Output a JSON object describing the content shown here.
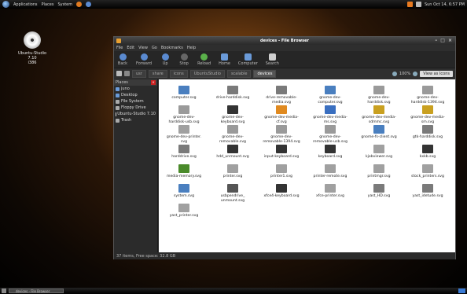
{
  "top_panel": {
    "menus": [
      "Applications",
      "Places",
      "System"
    ],
    "clock": "Sun Oct 14, 6:57 PM"
  },
  "desktop": {
    "icon_label_line1": "Ubuntu-Studio 7.10",
    "icon_label_line2": "i386"
  },
  "window": {
    "title": "devices - File Browser",
    "menu": [
      "File",
      "Edit",
      "View",
      "Go",
      "Bookmarks",
      "Help"
    ],
    "toolbar": [
      "Back",
      "Forward",
      "Up",
      "Stop",
      "Reload",
      "Home",
      "Computer",
      "Search"
    ],
    "breadcrumbs": [
      "usr",
      "share",
      "icons",
      "UbuntuStudio",
      "scalable",
      "devices"
    ],
    "zoom_label": "100%",
    "view_mode": "View as Icons",
    "sidebar_title": "Places",
    "sidebar_items": [
      "juno",
      "Desktop",
      "File System",
      "Floppy Drive",
      "Ubuntu-Studio 7.10",
      "Trash"
    ],
    "status": "37 items, Free space: 32.8 GB",
    "files": [
      [
        "computer.svg"
      ],
      [
        "drive-harddisk.svg"
      ],
      [
        "drive-removable-",
        "media.svg"
      ],
      [
        "gnome-dev-",
        "computer.svg"
      ],
      [
        "gnome-dev-",
        "harddisk.svg"
      ],
      [
        "gnome-dev-",
        "harddisk-1394.svg"
      ],
      [
        "gnome-dev-",
        "harddisk-usb.svg"
      ],
      [
        "gnome-dev-",
        "keyboard.svg"
      ],
      [
        "gnome-dev-media-",
        "cf.svg"
      ],
      [
        "gnome-dev-media-",
        "ms.svg"
      ],
      [
        "gnome-dev-media-",
        "sdmmc.svg"
      ],
      [
        "gnome-dev-media-",
        "sm.svg"
      ],
      [
        "gnome-dev-printer.",
        "svg"
      ],
      [
        "gnome-dev-",
        "removable.svg"
      ],
      [
        "gnome-dev-",
        "removable-1394.svg"
      ],
      [
        "gnome-dev-",
        "removable-usb.svg"
      ],
      [
        "gnome-fs-client.svg"
      ],
      [
        "gtk-harddisk.svg"
      ],
      [
        "harddrive.svg"
      ],
      [
        "hdd_unmount.svg"
      ],
      [
        "input-keyboard.svg"
      ],
      [
        "keyboard.svg"
      ],
      [
        "kjobviewer.svg"
      ],
      [
        "kxkb.svg"
      ],
      [
        "media-memory.svg"
      ],
      [
        "printer.svg"
      ],
      [
        "printer1.svg"
      ],
      [
        "printer-remote.svg"
      ],
      [
        "printmgr.svg"
      ],
      [
        "stock_printers.svg"
      ],
      [
        "system.svg"
      ],
      [
        "usbpendrive_",
        "unmount.svg"
      ],
      [
        "xfce4-keyboard.svg"
      ],
      [
        "xfce-printer.svg"
      ],
      [
        "yast_HD.svg"
      ],
      [
        "yast_idetude.svg"
      ],
      [
        "yast_printer.svg"
      ]
    ],
    "file_icon_kinds": [
      "monitor",
      "drive",
      "drive",
      "monitor",
      "disk-doc",
      "disk-doc",
      "disk-doc",
      "keyboard",
      "card-orange",
      "card-blue",
      "card-gold",
      "card-gold",
      "printer",
      "disk-doc",
      "disk-doc",
      "disk-doc",
      "monitor",
      "drive",
      "drive",
      "keyboard",
      "keyboard",
      "keyboard",
      "printer",
      "keyboard",
      "chip",
      "printer",
      "printer",
      "printer",
      "printer",
      "printer",
      "monitor",
      "usb",
      "keyboard",
      "printer",
      "drive",
      "drive",
      "printer"
    ],
    "icon_colors": {
      "monitor": "#4a7fbf",
      "drive": "#7a7a7a",
      "disk-doc": "#9a9a9a",
      "keyboard": "#333333",
      "card-orange": "#e08a20",
      "card-blue": "#3a6fc0",
      "card-gold": "#c9a020",
      "printer": "#a0a0a0",
      "chip": "#4a8a2a",
      "usb": "#555555"
    }
  }
}
